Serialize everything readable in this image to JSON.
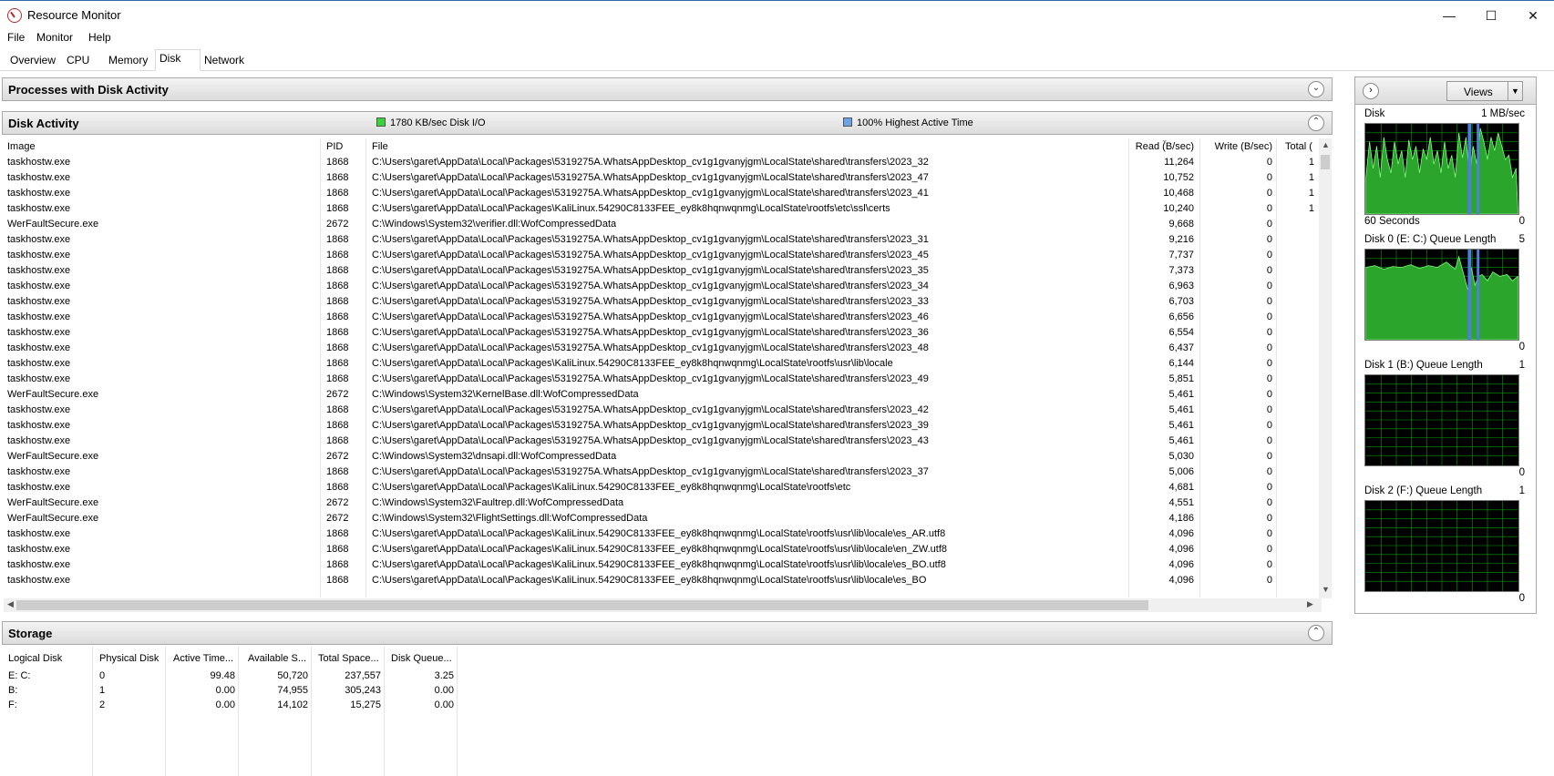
{
  "window": {
    "title": "Resource Monitor"
  },
  "menu": [
    "File",
    "Monitor",
    "Help"
  ],
  "tabs": [
    "Overview",
    "CPU",
    "Memory",
    "Disk",
    "Network"
  ],
  "active_tab": "Disk",
  "processes_section": {
    "title": "Processes with Disk Activity"
  },
  "disk_activity": {
    "title": "Disk Activity",
    "legend_io": "1780 KB/sec Disk I/O",
    "legend_active": "100% Highest Active Time",
    "io_color": "#39d439",
    "active_color": "#6aa3e8",
    "columns": [
      "Image",
      "PID",
      "File",
      "Read (B/sec)",
      "Write (B/sec)",
      "Total ("
    ],
    "rows": [
      [
        "taskhostw.exe",
        "1868",
        "C:\\Users\\garet\\AppData\\Local\\Packages\\5319275A.WhatsAppDesktop_cv1g1gvanyjgm\\LocalState\\shared\\transfers\\2023_32",
        "11,264",
        "0",
        "1"
      ],
      [
        "taskhostw.exe",
        "1868",
        "C:\\Users\\garet\\AppData\\Local\\Packages\\5319275A.WhatsAppDesktop_cv1g1gvanyjgm\\LocalState\\shared\\transfers\\2023_47",
        "10,752",
        "0",
        "1"
      ],
      [
        "taskhostw.exe",
        "1868",
        "C:\\Users\\garet\\AppData\\Local\\Packages\\5319275A.WhatsAppDesktop_cv1g1gvanyjgm\\LocalState\\shared\\transfers\\2023_41",
        "10,468",
        "0",
        "1"
      ],
      [
        "taskhostw.exe",
        "1868",
        "C:\\Users\\garet\\AppData\\Local\\Packages\\KaliLinux.54290C8133FEE_ey8k8hqnwqnmg\\LocalState\\rootfs\\etc\\ssl\\certs",
        "10,240",
        "0",
        "1"
      ],
      [
        "WerFaultSecure.exe",
        "2672",
        "C:\\Windows\\System32\\verifier.dll:WofCompressedData",
        "9,668",
        "0",
        ""
      ],
      [
        "taskhostw.exe",
        "1868",
        "C:\\Users\\garet\\AppData\\Local\\Packages\\5319275A.WhatsAppDesktop_cv1g1gvanyjgm\\LocalState\\shared\\transfers\\2023_31",
        "9,216",
        "0",
        ""
      ],
      [
        "taskhostw.exe",
        "1868",
        "C:\\Users\\garet\\AppData\\Local\\Packages\\5319275A.WhatsAppDesktop_cv1g1gvanyjgm\\LocalState\\shared\\transfers\\2023_45",
        "7,737",
        "0",
        ""
      ],
      [
        "taskhostw.exe",
        "1868",
        "C:\\Users\\garet\\AppData\\Local\\Packages\\5319275A.WhatsAppDesktop_cv1g1gvanyjgm\\LocalState\\shared\\transfers\\2023_35",
        "7,373",
        "0",
        ""
      ],
      [
        "taskhostw.exe",
        "1868",
        "C:\\Users\\garet\\AppData\\Local\\Packages\\5319275A.WhatsAppDesktop_cv1g1gvanyjgm\\LocalState\\shared\\transfers\\2023_34",
        "6,963",
        "0",
        ""
      ],
      [
        "taskhostw.exe",
        "1868",
        "C:\\Users\\garet\\AppData\\Local\\Packages\\5319275A.WhatsAppDesktop_cv1g1gvanyjgm\\LocalState\\shared\\transfers\\2023_33",
        "6,703",
        "0",
        ""
      ],
      [
        "taskhostw.exe",
        "1868",
        "C:\\Users\\garet\\AppData\\Local\\Packages\\5319275A.WhatsAppDesktop_cv1g1gvanyjgm\\LocalState\\shared\\transfers\\2023_46",
        "6,656",
        "0",
        ""
      ],
      [
        "taskhostw.exe",
        "1868",
        "C:\\Users\\garet\\AppData\\Local\\Packages\\5319275A.WhatsAppDesktop_cv1g1gvanyjgm\\LocalState\\shared\\transfers\\2023_36",
        "6,554",
        "0",
        ""
      ],
      [
        "taskhostw.exe",
        "1868",
        "C:\\Users\\garet\\AppData\\Local\\Packages\\5319275A.WhatsAppDesktop_cv1g1gvanyjgm\\LocalState\\shared\\transfers\\2023_48",
        "6,437",
        "0",
        ""
      ],
      [
        "taskhostw.exe",
        "1868",
        "C:\\Users\\garet\\AppData\\Local\\Packages\\KaliLinux.54290C8133FEE_ey8k8hqnwqnmg\\LocalState\\rootfs\\usr\\lib\\locale",
        "6,144",
        "0",
        ""
      ],
      [
        "taskhostw.exe",
        "1868",
        "C:\\Users\\garet\\AppData\\Local\\Packages\\5319275A.WhatsAppDesktop_cv1g1gvanyjgm\\LocalState\\shared\\transfers\\2023_49",
        "5,851",
        "0",
        ""
      ],
      [
        "WerFaultSecure.exe",
        "2672",
        "C:\\Windows\\System32\\KernelBase.dll:WofCompressedData",
        "5,461",
        "0",
        ""
      ],
      [
        "taskhostw.exe",
        "1868",
        "C:\\Users\\garet\\AppData\\Local\\Packages\\5319275A.WhatsAppDesktop_cv1g1gvanyjgm\\LocalState\\shared\\transfers\\2023_42",
        "5,461",
        "0",
        ""
      ],
      [
        "taskhostw.exe",
        "1868",
        "C:\\Users\\garet\\AppData\\Local\\Packages\\5319275A.WhatsAppDesktop_cv1g1gvanyjgm\\LocalState\\shared\\transfers\\2023_39",
        "5,461",
        "0",
        ""
      ],
      [
        "taskhostw.exe",
        "1868",
        "C:\\Users\\garet\\AppData\\Local\\Packages\\5319275A.WhatsAppDesktop_cv1g1gvanyjgm\\LocalState\\shared\\transfers\\2023_43",
        "5,461",
        "0",
        ""
      ],
      [
        "WerFaultSecure.exe",
        "2672",
        "C:\\Windows\\System32\\dnsapi.dll:WofCompressedData",
        "5,030",
        "0",
        ""
      ],
      [
        "taskhostw.exe",
        "1868",
        "C:\\Users\\garet\\AppData\\Local\\Packages\\5319275A.WhatsAppDesktop_cv1g1gvanyjgm\\LocalState\\shared\\transfers\\2023_37",
        "5,006",
        "0",
        ""
      ],
      [
        "taskhostw.exe",
        "1868",
        "C:\\Users\\garet\\AppData\\Local\\Packages\\KaliLinux.54290C8133FEE_ey8k8hqnwqnmg\\LocalState\\rootfs\\etc",
        "4,681",
        "0",
        ""
      ],
      [
        "WerFaultSecure.exe",
        "2672",
        "C:\\Windows\\System32\\Faultrep.dll:WofCompressedData",
        "4,551",
        "0",
        ""
      ],
      [
        "WerFaultSecure.exe",
        "2672",
        "C:\\Windows\\System32\\FlightSettings.dll:WofCompressedData",
        "4,186",
        "0",
        ""
      ],
      [
        "taskhostw.exe",
        "1868",
        "C:\\Users\\garet\\AppData\\Local\\Packages\\KaliLinux.54290C8133FEE_ey8k8hqnwqnmg\\LocalState\\rootfs\\usr\\lib\\locale\\es_AR.utf8",
        "4,096",
        "0",
        ""
      ],
      [
        "taskhostw.exe",
        "1868",
        "C:\\Users\\garet\\AppData\\Local\\Packages\\KaliLinux.54290C8133FEE_ey8k8hqnwqnmg\\LocalState\\rootfs\\usr\\lib\\locale\\en_ZW.utf8",
        "4,096",
        "0",
        ""
      ],
      [
        "taskhostw.exe",
        "1868",
        "C:\\Users\\garet\\AppData\\Local\\Packages\\KaliLinux.54290C8133FEE_ey8k8hqnwqnmg\\LocalState\\rootfs\\usr\\lib\\locale\\es_BO.utf8",
        "4,096",
        "0",
        ""
      ],
      [
        "taskhostw.exe",
        "1868",
        "C:\\Users\\garet\\AppData\\Local\\Packages\\KaliLinux.54290C8133FEE_ey8k8hqnwqnmg\\LocalState\\rootfs\\usr\\lib\\locale\\es_BO",
        "4,096",
        "0",
        ""
      ]
    ]
  },
  "storage": {
    "title": "Storage",
    "columns": [
      "Logical Disk",
      "Physical Disk",
      "Active Time...",
      "Available S...",
      "Total Space...",
      "Disk Queue..."
    ],
    "rows": [
      [
        "E: C:",
        "0",
        "99.48",
        "50,720",
        "237,557",
        "3.25"
      ],
      [
        "B:",
        "1",
        "0.00",
        "74,955",
        "305,243",
        "0.00"
      ],
      [
        "F:",
        "2",
        "0.00",
        "14,102",
        "15,275",
        "0.00"
      ]
    ]
  },
  "right_pane": {
    "views_label": "Views",
    "graphs": [
      {
        "title": "Disk",
        "max": "1 MB/sec",
        "bottom_left": "60 Seconds",
        "bottom_right": "0"
      },
      {
        "title": "Disk 0 (E: C:) Queue Length",
        "max": "5",
        "bottom_left": "",
        "bottom_right": "0"
      },
      {
        "title": "Disk 1 (B:) Queue Length",
        "max": "1",
        "bottom_left": "",
        "bottom_right": "0"
      },
      {
        "title": "Disk 2 (F:) Queue Length",
        "max": "1",
        "bottom_left": "",
        "bottom_right": "0"
      }
    ]
  }
}
